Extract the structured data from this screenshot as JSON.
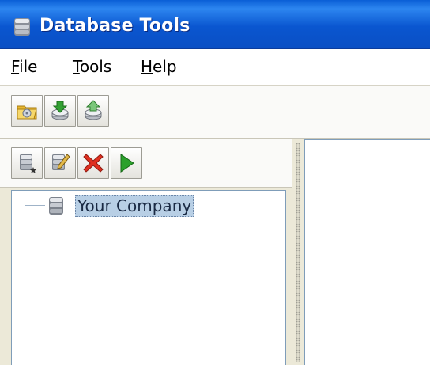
{
  "window": {
    "title": "Database Tools",
    "icon": "database-icon"
  },
  "menu": [
    {
      "label": "File",
      "mnemonic": "F",
      "rest": "ile"
    },
    {
      "label": "Tools",
      "mnemonic": "T",
      "rest": "ools"
    },
    {
      "label": "Help",
      "mnemonic": "H",
      "rest": "elp"
    }
  ],
  "toolbar": [
    {
      "icon": "open-folder-icon"
    },
    {
      "icon": "import-icon"
    },
    {
      "icon": "export-icon"
    }
  ],
  "tree_toolbar": [
    {
      "icon": "new-database-icon"
    },
    {
      "icon": "edit-database-icon"
    },
    {
      "icon": "delete-icon"
    },
    {
      "icon": "run-icon"
    }
  ],
  "tree": {
    "nodes": [
      {
        "label": "Your Company",
        "icon": "database-icon",
        "selected": true
      }
    ]
  },
  "colors": {
    "titlebar": "#0a56d0",
    "selection": "#b8cfe5",
    "delete": "#e03020",
    "run": "#2ba02b"
  }
}
